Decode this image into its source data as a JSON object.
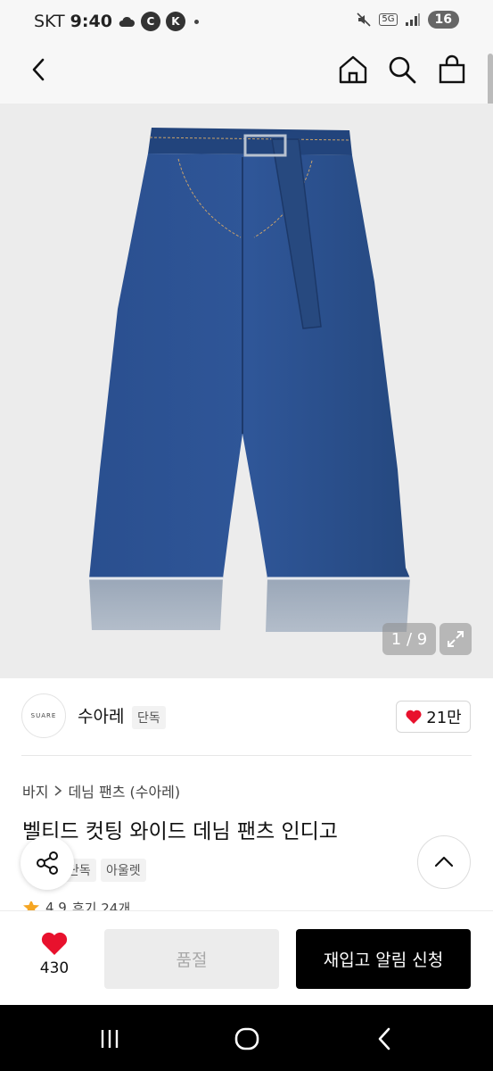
{
  "status_bar": {
    "carrier": "SKT",
    "time": "9:40",
    "network": "5G",
    "battery": "16"
  },
  "header": {
    "icons": [
      "back-arrow-icon",
      "home-icon",
      "search-icon",
      "shopping-bag-icon"
    ]
  },
  "gallery": {
    "counter": "1 / 9",
    "background": "#ececec"
  },
  "brand": {
    "logo_text": "SUARE",
    "name": "수아레",
    "tag": "단독",
    "likes": "21만"
  },
  "product": {
    "breadcrumb": [
      "바지",
      "데님 팬츠 (수아레)"
    ],
    "title": "벨티드 컷팅 와이드 데님 팬츠 인디고",
    "tags": [
      "단독",
      "아울렛"
    ],
    "rating": "4.9",
    "reviews": "후기 24개"
  },
  "bottom_bar": {
    "favorite_count": "430",
    "soldout_label": "품절",
    "restock_label": "재입고 알림 신청"
  },
  "colors": {
    "accent_red": "#e8112d",
    "black": "#000000",
    "denim": "#244a8a"
  }
}
